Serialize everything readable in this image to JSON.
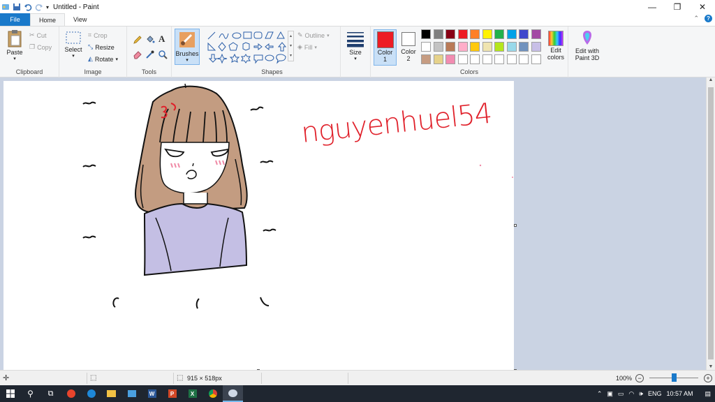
{
  "window": {
    "title": "Untitled - Paint",
    "controls": [
      "—",
      "❐",
      "✕"
    ]
  },
  "tabs": {
    "file": "File",
    "home": "Home",
    "view": "View"
  },
  "clipboard": {
    "paste": "Paste",
    "cut": "Cut",
    "copy": "Copy",
    "label": "Clipboard"
  },
  "image": {
    "select": "Select",
    "crop": "Crop",
    "resize": "Resize",
    "rotate": "Rotate",
    "label": "Image"
  },
  "tools": {
    "label": "Tools"
  },
  "brushes": {
    "label": "Brushes"
  },
  "shapes": {
    "outline": "Outline",
    "fill": "Fill",
    "label": "Shapes"
  },
  "size": {
    "label": "Size"
  },
  "colors": {
    "color1": "Color 1",
    "color2": "Color 2",
    "edit_colors": "Edit colors",
    "label": "Colors",
    "color1_value": "#ed1c24",
    "color2_value": "#ffffff",
    "palette": [
      [
        "#000000",
        "#7f7f7f",
        "#880015",
        "#ed1c24",
        "#ff7f27",
        "#fff200",
        "#22b14c",
        "#00a2e8",
        "#3f48cc",
        "#a349a4"
      ],
      [
        "#ffffff",
        "#c3c3c3",
        "#b97a57",
        "#ffaec9",
        "#ffc90e",
        "#efe4b0",
        "#b5e61d",
        "#99d9ea",
        "#7092be",
        "#c8bfe7"
      ],
      [
        "#c69c82",
        "#e6d28a",
        "#f28cb1",
        "#ffffff",
        "#ffffff",
        "#ffffff",
        "#ffffff",
        "#ffffff",
        "#ffffff",
        "#ffffff"
      ]
    ]
  },
  "paint3d": {
    "label": "Edit with Paint 3D"
  },
  "drawing": {
    "handwriting": "nguyenhuel54"
  },
  "status": {
    "canvas_size": "915 × 518px",
    "zoom": "100%",
    "zoom_level": 0.5
  },
  "taskbar": {
    "lang": "ENG",
    "time": "10:57 AM"
  }
}
